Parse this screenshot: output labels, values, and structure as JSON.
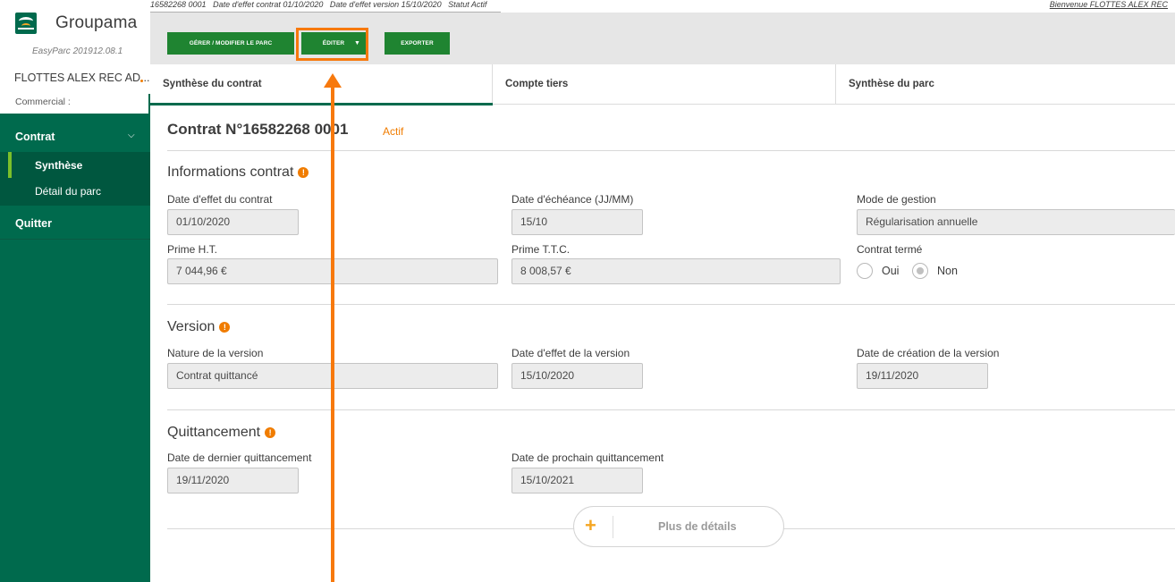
{
  "brand": {
    "name": "Groupama",
    "version": "EasyParc 201912.08.1",
    "logo_icon": "groupama-logo-icon"
  },
  "sidebar": {
    "user": "FLOTTES ALEX REC AD...",
    "commercial_label": "Commercial :",
    "contrat_label": "Contrat",
    "items": [
      {
        "label": "Synthèse",
        "active": true
      },
      {
        "label": "Détail du parc",
        "active": false
      }
    ],
    "quitter_label": "Quitter"
  },
  "topbar": {
    "info": "16582268 0001   Date d'effet contrat 01/10/2020   Date d'effet version 15/10/2020   Statut Actif",
    "welcome": "Bienvenue FLOTTES ALEX REC"
  },
  "toolbar": {
    "gerer_label": "GÉRER / MODIFIER LE PARC",
    "editer_label": "ÉDITER",
    "exporter_label": "EXPORTER"
  },
  "tabs": [
    {
      "label": "Synthèse du contrat",
      "active": true
    },
    {
      "label": "Compte tiers",
      "active": false
    },
    {
      "label": "Synthèse du parc",
      "active": false
    }
  ],
  "contract": {
    "title": "Contrat N°16582268 0001",
    "status": "Actif"
  },
  "informations": {
    "title": "Informations contrat",
    "date_effet_label": "Date d'effet du contrat",
    "date_effet_value": "01/10/2020",
    "date_echeance_label": "Date d'échéance (JJ/MM)",
    "date_echeance_value": "15/10",
    "mode_gestion_label": "Mode de gestion",
    "mode_gestion_value": "Régularisation annuelle",
    "prime_ht_label": "Prime H.T.",
    "prime_ht_value": "7 044,96 €",
    "prime_ttc_label": "Prime T.T.C.",
    "prime_ttc_value": "8 008,57 €",
    "contrat_terme_label": "Contrat termé",
    "oui_label": "Oui",
    "non_label": "Non",
    "selected": "Non"
  },
  "version": {
    "title": "Version",
    "nature_label": "Nature de la version",
    "nature_value": "Contrat quittancé",
    "date_effet_label": "Date d'effet de la version",
    "date_effet_value": "15/10/2020",
    "date_creation_label": "Date de création de la version",
    "date_creation_value": "19/11/2020"
  },
  "quittancement": {
    "title": "Quittancement",
    "dernier_label": "Date de dernier quittancement",
    "dernier_value": "19/11/2020",
    "prochain_label": "Date de prochain quittancement",
    "prochain_value": "15/10/2021"
  },
  "details": {
    "label": "Plus de détails",
    "plus_symbol": "+"
  },
  "colors": {
    "sidebar": "#006a4d",
    "button": "#1f8431",
    "accent": "#f07c00",
    "annotation": "#f7790d"
  }
}
